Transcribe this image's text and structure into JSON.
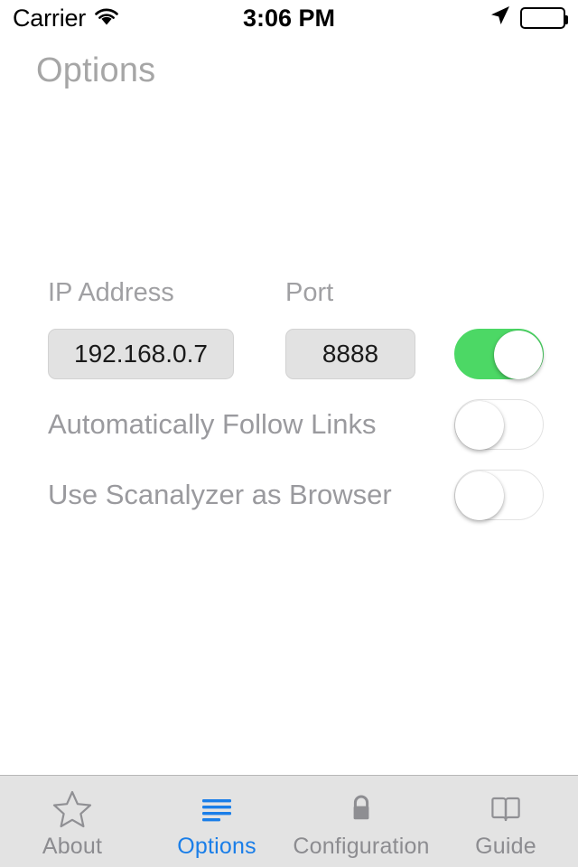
{
  "status_bar": {
    "carrier": "Carrier",
    "wifi_icon": "wifi-icon",
    "time": "3:06 PM",
    "location_icon": "location-arrow-icon",
    "battery_icon": "battery-full-icon"
  },
  "header": {
    "title": "Options"
  },
  "form": {
    "ip": {
      "label": "IP Address",
      "value": "192.168.0.7",
      "placeholder": "IP Address"
    },
    "port": {
      "label": "Port",
      "value": "8888",
      "placeholder": "Port"
    },
    "switches": [
      {
        "name": "server-enabled",
        "label": "",
        "state": "on"
      },
      {
        "name": "auto-follow-links",
        "label": "Automatically Follow Links",
        "state": "off"
      },
      {
        "name": "use-scanalyzer-as-browser",
        "label": "Use Scanalyzer as Browser",
        "state": "off"
      }
    ]
  },
  "tab_bar": {
    "active_color": "#1a7ee8",
    "inactive_color": "#8c8c90",
    "background": "#e3e3e3",
    "items": [
      {
        "label": "About",
        "icon": "star-icon",
        "active": false
      },
      {
        "label": "Options",
        "icon": "list-lines-icon",
        "active": true
      },
      {
        "label": "Configuration",
        "icon": "lock-icon",
        "active": false
      },
      {
        "label": "Guide",
        "icon": "book-icon",
        "active": false
      }
    ]
  }
}
